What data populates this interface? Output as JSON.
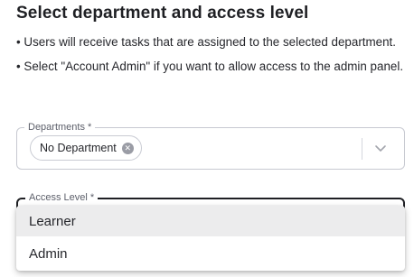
{
  "heading": "Select department and access level",
  "bullets": [
    "• Users will receive tasks that are assigned to the selected department.",
    "• Select \"Account Admin\" if you want to allow access to the admin panel."
  ],
  "departments": {
    "label": "Departments *",
    "selected_chip": "No Department",
    "chip_remove_icon": "close-circle-icon",
    "dropdown_icon": "chevron-down-icon"
  },
  "access_level": {
    "label": "Access Level *",
    "options": [
      "Learner",
      "Admin"
    ],
    "highlighted_index": 0
  },
  "colors": {
    "border": "#c7c9d1",
    "focused_border": "#1f2024",
    "highlight": "#ececed",
    "chip_icon": "#9a9ca5"
  }
}
